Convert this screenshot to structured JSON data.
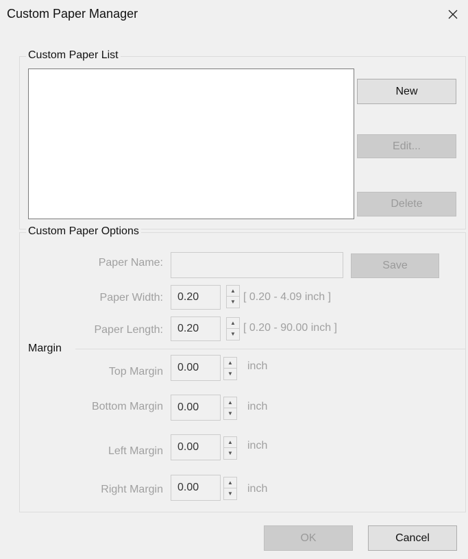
{
  "window": {
    "title": "Custom Paper Manager",
    "close_glyph": "✕"
  },
  "paper_list": {
    "group_label": "Custom Paper List",
    "items": [],
    "new_label": "New",
    "edit_label": "Edit...",
    "delete_label": "Delete"
  },
  "options": {
    "group_label": "Custom Paper Options",
    "paper_name_label": "Paper Name:",
    "paper_name_value": "",
    "save_label": "Save",
    "paper_width_label": "Paper Width:",
    "paper_width_value": "0.20",
    "paper_width_range": "[ 0.20 - 4.09 inch ]",
    "paper_length_label": "Paper Length:",
    "paper_length_value": "0.20",
    "paper_length_range": "[ 0.20 - 90.00 inch ]"
  },
  "margin": {
    "label": "Margin",
    "unit": "inch",
    "top_label": "Top Margin",
    "top_value": "0.00",
    "bottom_label": "Bottom Margin",
    "bottom_value": "0.00",
    "left_label": "Left Margin",
    "left_value": "0.00",
    "right_label": "Right Margin",
    "right_value": "0.00"
  },
  "footer": {
    "ok_label": "OK",
    "cancel_label": "Cancel"
  },
  "icons": {
    "close": "close-icon",
    "spin_up": "spin-up-icon",
    "spin_down": "spin-down-icon"
  },
  "colors": {
    "background": "#f0f0f0",
    "disabled_text": "#a0a0a0",
    "button_face": "#e1e1e1",
    "disabled_button": "#cccccc",
    "focus_border": "#0078d7"
  }
}
